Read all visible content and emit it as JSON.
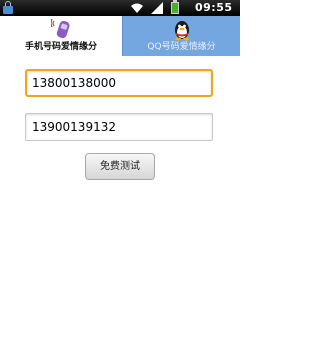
{
  "status_bar": {
    "time": "09:55",
    "icons": [
      "lock-icon",
      "wifi-icon",
      "signal-icon",
      "battery-icon"
    ]
  },
  "tabs": [
    {
      "label": "手机号码爱情缘分",
      "icon": "phone-icon",
      "selected": true
    },
    {
      "label": "QQ号码爱情缘分",
      "icon": "qq-penguin-icon",
      "selected": false
    }
  ],
  "form": {
    "phone_1": "13800138000",
    "phone_2": "13900139132",
    "button_label": "免费测试"
  },
  "colors": {
    "status_bar": "#000000",
    "tab_inactive": "#74a6df",
    "focus_border": "#f2a51a",
    "background": "#ffffff"
  }
}
